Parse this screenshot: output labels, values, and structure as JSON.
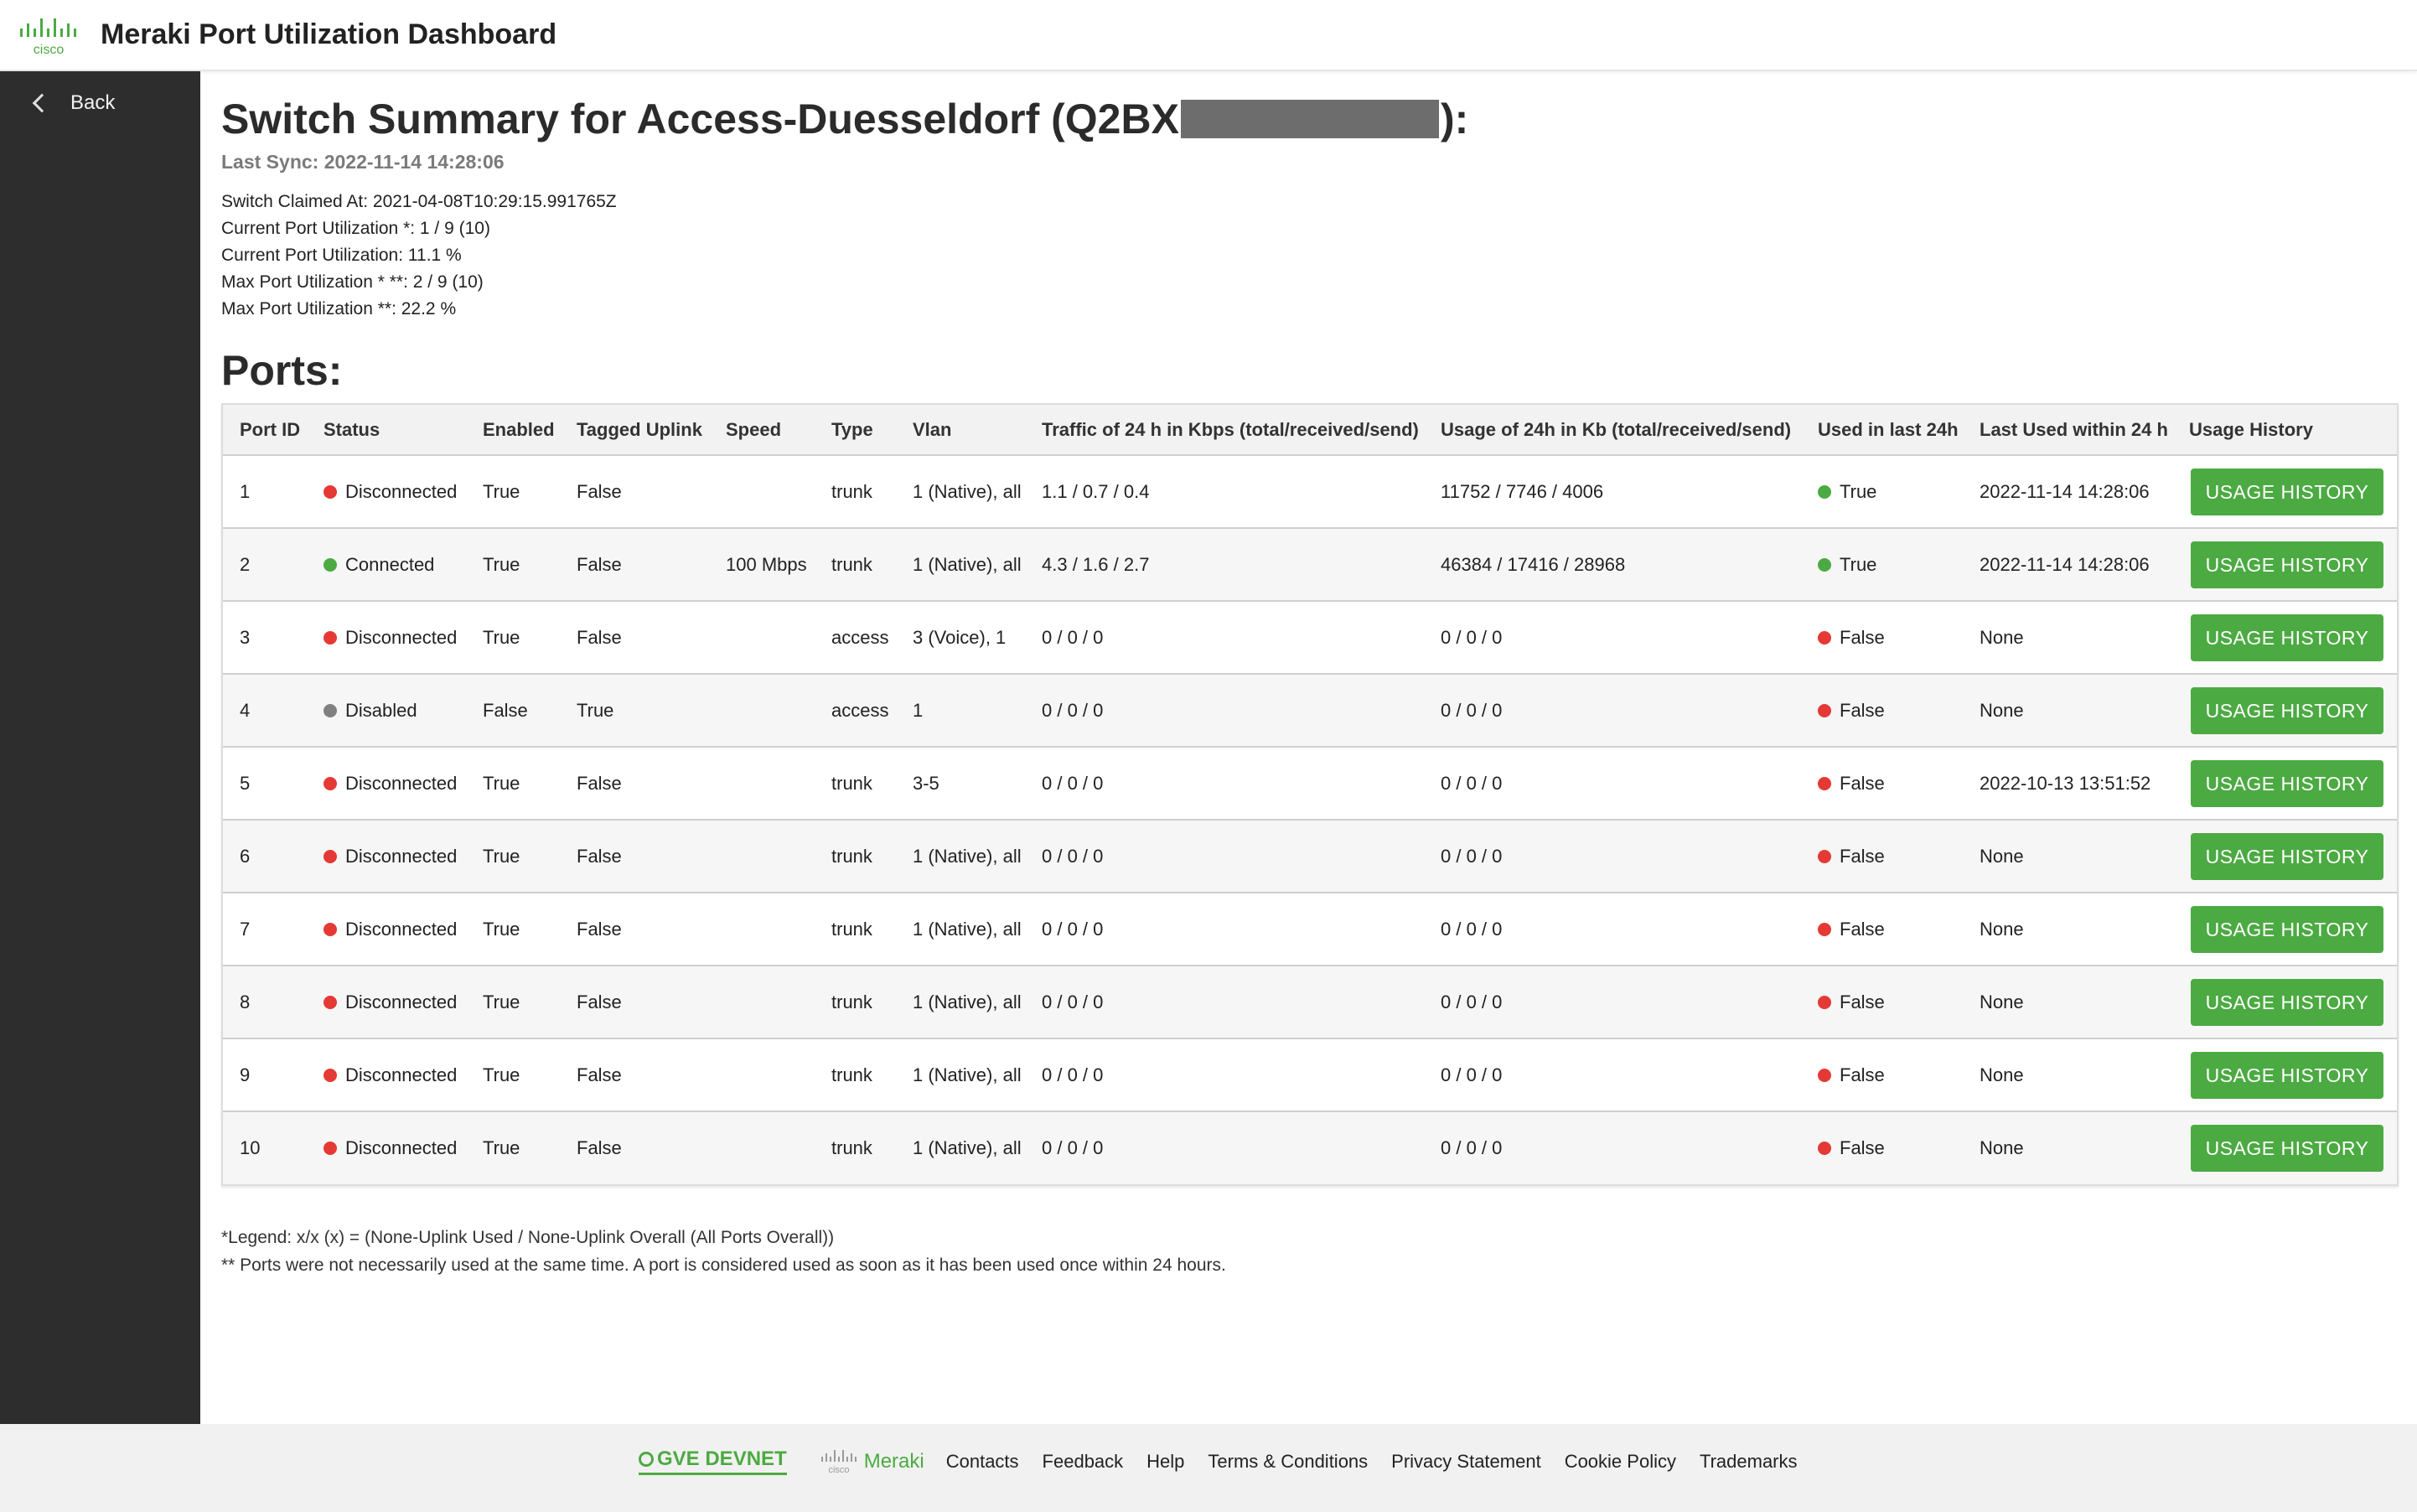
{
  "header": {
    "title": "Meraki Port Utilization Dashboard",
    "logo_text": "cisco"
  },
  "sidebar": {
    "back_label": "Back"
  },
  "summary": {
    "title_prefix": "Switch Summary for Access-Duesseldorf (Q2BX",
    "title_suffix": "):",
    "last_sync": "Last Sync: 2022-11-14 14:28:06",
    "lines": [
      "Switch Claimed At: 2021-04-08T10:29:15.991765Z",
      "Current Port Utilization *: 1 / 9 (10)",
      "Current Port Utilization: 11.1 %",
      "Max Port Utilization * **: 2 / 9 (10)",
      "Max Port Utilization **: 22.2 %"
    ]
  },
  "ports_title": "Ports:",
  "table": {
    "headers": [
      "Port ID",
      "Status",
      "Enabled",
      "Tagged Uplink",
      "Speed",
      "Type",
      "Vlan",
      "Traffic of 24 h in Kbps (total/received/send)",
      "Usage of 24h in Kb (total/received/send)",
      "Used in last 24h",
      "Last Used within 24 h",
      "Usage History"
    ],
    "button_label": "USAGE HISTORY",
    "rows": [
      {
        "id": "1",
        "status": "Disconnected",
        "status_color": "#e53935",
        "enabled": "True",
        "uplink": "False",
        "speed": "",
        "type": "trunk",
        "vlan": "1 (Native), all",
        "traffic": "1.1 / 0.7 / 0.4",
        "usage": "11752 / 7746 / 4006",
        "used": "True",
        "used_color": "#4caa42",
        "last_used": "2022-11-14 14:28:06"
      },
      {
        "id": "2",
        "status": "Connected",
        "status_color": "#4caa42",
        "enabled": "True",
        "uplink": "False",
        "speed": "100 Mbps",
        "type": "trunk",
        "vlan": "1 (Native), all",
        "traffic": "4.3 / 1.6 / 2.7",
        "usage": "46384 / 17416 / 28968",
        "used": "True",
        "used_color": "#4caa42",
        "last_used": "2022-11-14 14:28:06"
      },
      {
        "id": "3",
        "status": "Disconnected",
        "status_color": "#e53935",
        "enabled": "True",
        "uplink": "False",
        "speed": "",
        "type": "access",
        "vlan": "3 (Voice), 1",
        "traffic": "0 / 0 / 0",
        "usage": "0 / 0 / 0",
        "used": "False",
        "used_color": "#e53935",
        "last_used": "None"
      },
      {
        "id": "4",
        "status": "Disabled",
        "status_color": "#808080",
        "enabled": "False",
        "uplink": "True",
        "speed": "",
        "type": "access",
        "vlan": "1",
        "traffic": "0 / 0 / 0",
        "usage": "0 / 0 / 0",
        "used": "False",
        "used_color": "#e53935",
        "last_used": "None"
      },
      {
        "id": "5",
        "status": "Disconnected",
        "status_color": "#e53935",
        "enabled": "True",
        "uplink": "False",
        "speed": "",
        "type": "trunk",
        "vlan": "3-5",
        "traffic": "0 / 0 / 0",
        "usage": "0 / 0 / 0",
        "used": "False",
        "used_color": "#e53935",
        "last_used": "2022-10-13 13:51:52"
      },
      {
        "id": "6",
        "status": "Disconnected",
        "status_color": "#e53935",
        "enabled": "True",
        "uplink": "False",
        "speed": "",
        "type": "trunk",
        "vlan": "1 (Native), all",
        "traffic": "0 / 0 / 0",
        "usage": "0 / 0 / 0",
        "used": "False",
        "used_color": "#e53935",
        "last_used": "None"
      },
      {
        "id": "7",
        "status": "Disconnected",
        "status_color": "#e53935",
        "enabled": "True",
        "uplink": "False",
        "speed": "",
        "type": "trunk",
        "vlan": "1 (Native), all",
        "traffic": "0 / 0 / 0",
        "usage": "0 / 0 / 0",
        "used": "False",
        "used_color": "#e53935",
        "last_used": "None"
      },
      {
        "id": "8",
        "status": "Disconnected",
        "status_color": "#e53935",
        "enabled": "True",
        "uplink": "False",
        "speed": "",
        "type": "trunk",
        "vlan": "1 (Native), all",
        "traffic": "0 / 0 / 0",
        "usage": "0 / 0 / 0",
        "used": "False",
        "used_color": "#e53935",
        "last_used": "None"
      },
      {
        "id": "9",
        "status": "Disconnected",
        "status_color": "#e53935",
        "enabled": "True",
        "uplink": "False",
        "speed": "",
        "type": "trunk",
        "vlan": "1 (Native), all",
        "traffic": "0 / 0 / 0",
        "usage": "0 / 0 / 0",
        "used": "False",
        "used_color": "#e53935",
        "last_used": "None"
      },
      {
        "id": "10",
        "status": "Disconnected",
        "status_color": "#e53935",
        "enabled": "True",
        "uplink": "False",
        "speed": "",
        "type": "trunk",
        "vlan": "1 (Native), all",
        "traffic": "0 / 0 / 0",
        "usage": "0 / 0 / 0",
        "used": "False",
        "used_color": "#e53935",
        "last_used": "None"
      }
    ]
  },
  "legend": {
    "line1": "*Legend: x/x (x) = (None-Uplink Used / None-Uplink Overall (All Ports Overall))",
    "line2": "** Ports were not necessarily used at the same time. A port is considered used as soon as it has been used once within 24 hours."
  },
  "footer": {
    "gve_label": "GVE DEVNET",
    "meraki_label": "Meraki",
    "meraki_logo_text": "cisco",
    "links": [
      "Contacts",
      "Feedback",
      "Help",
      "Terms & Conditions",
      "Privacy Statement",
      "Cookie Policy",
      "Trademarks"
    ]
  },
  "colors": {
    "accent_green": "#4caa42",
    "sidebar": "#2d2d2d",
    "status_red": "#e53935",
    "status_gray": "#808080"
  },
  "icons": {
    "back": "chevron-left-icon",
    "brand": "cisco-logo-icon",
    "gve": "gve-devnet-icon"
  }
}
